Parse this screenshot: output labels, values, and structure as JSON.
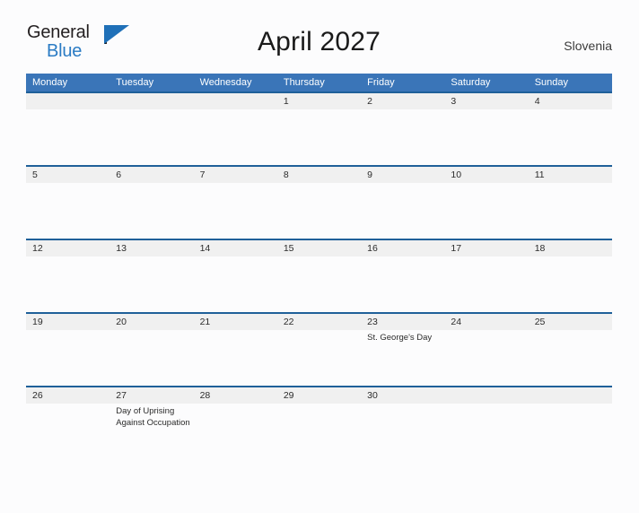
{
  "brand": {
    "name_part1": "General",
    "name_part2": "Blue",
    "triangle_color": "#1f70b8",
    "blue_text_color": "#2a7bc4"
  },
  "header": {
    "title": "April 2027",
    "location": "Slovenia"
  },
  "theme": {
    "header_blue": "#3a75b8",
    "row_rule_blue": "#1f6099",
    "date_band_gray": "#f0f0f0",
    "page_background": "#fcfcfd",
    "text_color": "#2b2b2b"
  },
  "calendar": {
    "weekdays": [
      "Monday",
      "Tuesday",
      "Wednesday",
      "Thursday",
      "Friday",
      "Saturday",
      "Sunday"
    ],
    "weeks": [
      [
        {
          "date": "",
          "event": ""
        },
        {
          "date": "",
          "event": ""
        },
        {
          "date": "",
          "event": ""
        },
        {
          "date": "1",
          "event": ""
        },
        {
          "date": "2",
          "event": ""
        },
        {
          "date": "3",
          "event": ""
        },
        {
          "date": "4",
          "event": ""
        }
      ],
      [
        {
          "date": "5",
          "event": ""
        },
        {
          "date": "6",
          "event": ""
        },
        {
          "date": "7",
          "event": ""
        },
        {
          "date": "8",
          "event": ""
        },
        {
          "date": "9",
          "event": ""
        },
        {
          "date": "10",
          "event": ""
        },
        {
          "date": "11",
          "event": ""
        }
      ],
      [
        {
          "date": "12",
          "event": ""
        },
        {
          "date": "13",
          "event": ""
        },
        {
          "date": "14",
          "event": ""
        },
        {
          "date": "15",
          "event": ""
        },
        {
          "date": "16",
          "event": ""
        },
        {
          "date": "17",
          "event": ""
        },
        {
          "date": "18",
          "event": ""
        }
      ],
      [
        {
          "date": "19",
          "event": ""
        },
        {
          "date": "20",
          "event": ""
        },
        {
          "date": "21",
          "event": ""
        },
        {
          "date": "22",
          "event": ""
        },
        {
          "date": "23",
          "event": "St. George's Day"
        },
        {
          "date": "24",
          "event": ""
        },
        {
          "date": "25",
          "event": ""
        }
      ],
      [
        {
          "date": "26",
          "event": ""
        },
        {
          "date": "27",
          "event": "Day of Uprising\nAgainst Occupation"
        },
        {
          "date": "28",
          "event": ""
        },
        {
          "date": "29",
          "event": ""
        },
        {
          "date": "30",
          "event": ""
        },
        {
          "date": "",
          "event": ""
        },
        {
          "date": "",
          "event": ""
        }
      ]
    ]
  }
}
